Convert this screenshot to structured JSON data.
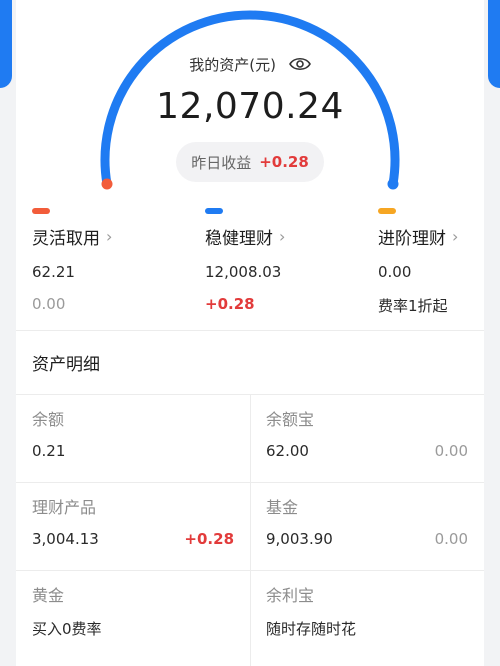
{
  "summary": {
    "label": "我的资产(元)",
    "total": "12,070.24",
    "yesterday_label": "昨日收益",
    "yesterday_value": "+0.28"
  },
  "gauge": {
    "colors": {
      "track": "#1f7bf2",
      "start_dot": "#f25c3a",
      "end_dot": "#1f7bf2"
    }
  },
  "categories": [
    {
      "name": "灵活取用",
      "color": "#f25c3a",
      "value": "62.21",
      "sub": "0.00"
    },
    {
      "name": "稳健理财",
      "color": "#1f7bf2",
      "value": "12,008.03",
      "sub": "+0.28"
    },
    {
      "name": "进阶理财",
      "color": "#f6a623",
      "value": "0.00",
      "sub": "费率1折起"
    }
  ],
  "detail": {
    "title": "资产明细",
    "items": [
      {
        "name": "余额",
        "value": "0.21",
        "right": ""
      },
      {
        "name": "余额宝",
        "value": "62.00",
        "right": "0.00"
      },
      {
        "name": "理财产品",
        "value": "3,004.13",
        "right": "+0.28"
      },
      {
        "name": "基金",
        "value": "9,003.90",
        "right": "0.00"
      },
      {
        "name": "黄金",
        "value": "买入0费率",
        "right": ""
      },
      {
        "name": "余利宝",
        "value": "随时存随时花",
        "right": ""
      }
    ]
  }
}
